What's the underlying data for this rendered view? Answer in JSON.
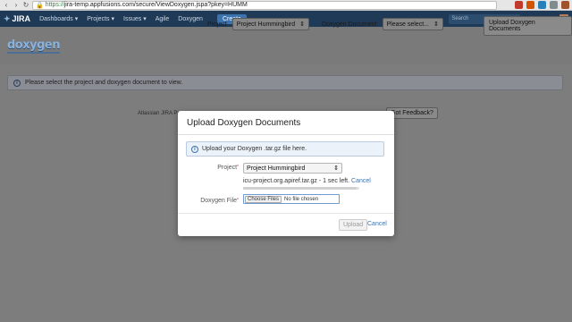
{
  "browser": {
    "url_scheme": "https://",
    "url_rest": "jira-temp.appfusions.com/secure/ViewDoxygen.jspa?pkey=HUMM"
  },
  "header": {
    "logo_text": "JIRA",
    "nav": [
      "Dashboards ▾",
      "Projects ▾",
      "Issues ▾",
      "Agile",
      "Doxygen"
    ],
    "create_label": "Create",
    "search_placeholder": "Search"
  },
  "toolbar": {
    "logo_text": "doxygen",
    "project_label": "Project",
    "project_value": "Project Hummingbird",
    "document_label": "Doxygen Document",
    "document_value": "Please select...",
    "upload_label": "Upload Doxygen Documents"
  },
  "info_banner": {
    "text": "Please select the project and doxygen document to view."
  },
  "footer": {
    "text": "Atlassian JIRA Pro",
    "feedback_label": "Got Feedback?"
  },
  "modal": {
    "title": "Upload Doxygen Documents",
    "info_text": "Upload your Doxygen .tar.gz file here.",
    "project_label": "Project",
    "project_value": "Project Hummingbird",
    "upload_status": "icu-project.org.apiref.tar.gz - 1 sec left.",
    "cancel_link": "Cancel",
    "file_label": "Doxygen File",
    "choose_files": "Choose Files",
    "no_file": "No file chosen",
    "upload_button": "Upload",
    "cancel_button": "Cancel",
    "progress_fraction": 0.98
  },
  "colors": {
    "header_bg": "#1f3a57",
    "accent": "#3b73af",
    "overlay": "#7d7d7d"
  }
}
